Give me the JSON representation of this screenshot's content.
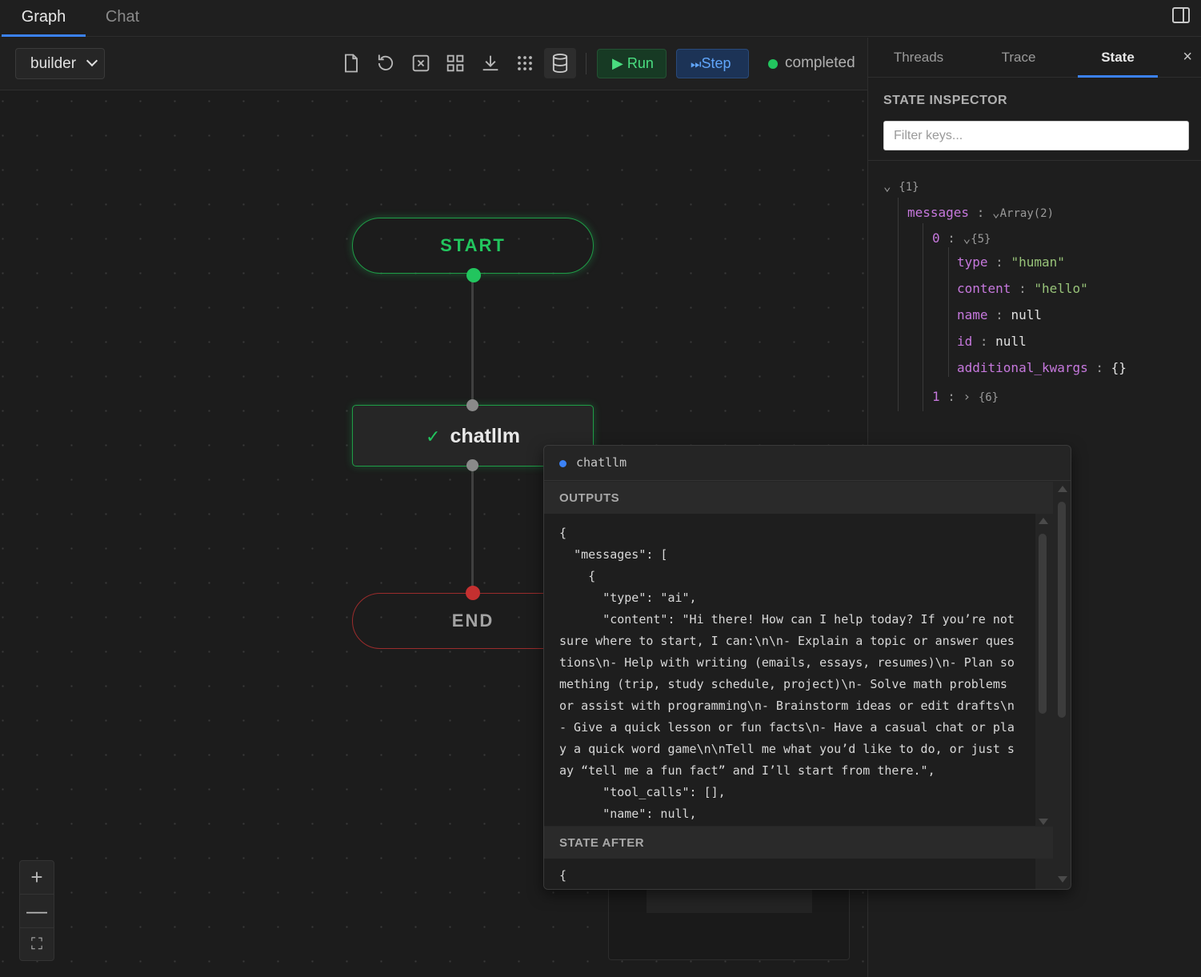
{
  "top_tabs": {
    "graph": "Graph",
    "chat": "Chat"
  },
  "toolbar": {
    "graph_select": "builder",
    "icons": [
      "file-icon",
      "undo-icon",
      "clear-icon",
      "layout-icon",
      "download-icon",
      "grid-dots-icon",
      "database-icon"
    ],
    "run_label": "Run",
    "step_label": "Step",
    "status": "completed",
    "status_color": "#22c55e"
  },
  "graph": {
    "nodes": {
      "start": "START",
      "chatllm": "chatllm",
      "end": "END"
    },
    "colors": {
      "start": "#22c55e",
      "end": "#c53030",
      "active": "#22c55e"
    }
  },
  "zoom": {
    "in": "+",
    "out": "—",
    "fit": "⛶"
  },
  "right_panel": {
    "tabs": {
      "threads": "Threads",
      "trace": "Trace",
      "state": "State"
    },
    "close": "×",
    "title": "STATE INSPECTOR",
    "filter_placeholder": "Filter keys...",
    "tree": {
      "root": "{1}",
      "messages_key": "messages",
      "messages_meta": "Array(2)",
      "item0_index": "0",
      "item0_meta": "{5}",
      "fields": [
        {
          "key": "type",
          "value": "\"human\""
        },
        {
          "key": "content",
          "value": "\"hello\""
        },
        {
          "key": "name",
          "value": "null"
        },
        {
          "key": "id",
          "value": "null"
        },
        {
          "key": "additional_kwargs",
          "value": "{}"
        }
      ],
      "item1_index": "1",
      "item1_meta": "{6}"
    }
  },
  "popup": {
    "title": "chatllm",
    "outputs_label": "OUTPUTS",
    "outputs_json": "{\n  \"messages\": [\n    {\n      \"type\": \"ai\",\n      \"content\": \"Hi there! How can I help today? If you’re not sure where to start, I can:\\n\\n- Explain a topic or answer questions\\n- Help with writing (emails, essays, resumes)\\n- Plan something (trip, study schedule, project)\\n- Solve math problems or assist with programming\\n- Brainstorm ideas or edit drafts\\n- Give a quick lesson or fun facts\\n- Have a casual chat or play a quick word game\\n\\nTell me what you’d like to do, or just say “tell me a fun fact” and I’ll start from there.\",\n      \"tool_calls\": [],\n      \"name\": null,",
    "state_after_label": "STATE AFTER",
    "state_after_json": "{"
  }
}
